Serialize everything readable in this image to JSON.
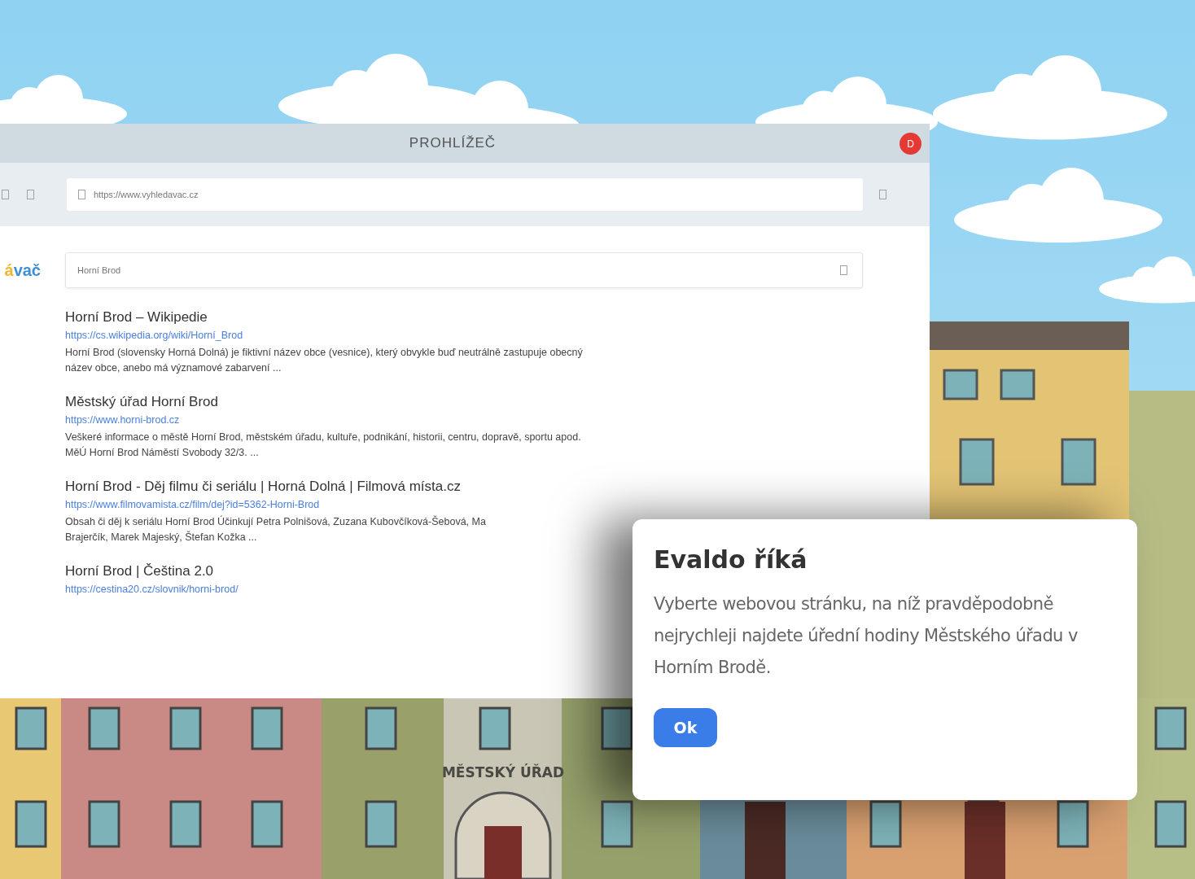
{
  "scene": {
    "building_sign": "MĚSTSKÝ ÚŘAD"
  },
  "browser": {
    "title": "PROHLÍŽEČ",
    "close_label": "D",
    "address": "https://www.vyhledavac.cz",
    "logo": [
      {
        "text": "á",
        "color": "#f2b632"
      },
      {
        "text": "vač",
        "color": "#3d8fd6"
      }
    ],
    "search": {
      "value": "Horní Brod"
    },
    "results": [
      {
        "title": "Horní Brod – Wikipedie",
        "url": "https://cs.wikipedia.org/wiki/Horní_Brod",
        "snippet": [
          "Horní Brod (slovensky Horná Dolná) je fiktivní název obce (vesnice), který obvykle buď neutrálně zastupuje obecný",
          "název obce, anebo má významové zabarvení ..."
        ]
      },
      {
        "title": "Městský úřad Horní Brod",
        "url": "https://www.horni-brod.cz",
        "snippet": [
          "Veškeré informace o městě Horní Brod, městském úřadu, kultuře, podnikání, historii, centru, dopravě, sportu apod.",
          "MěÚ Horní Brod Náměstí Svobody 32/3. ..."
        ]
      },
      {
        "title": "Horní Brod - Děj filmu či seriálu | Horná Dolná | Filmová místa.cz",
        "url": "https://www.filmovamista.cz/film/dej?id=5362-Horni-Brod",
        "snippet": [
          "Obsah či děj k seriálu Horní Brod Účinkují Petra Polnišová, Zuzana Kubovčíková-Šebová, Ma",
          "Brajerčík, Marek Majeský, Štefan Kožka ..."
        ]
      },
      {
        "title": "Horní Brod | Čeština 2.0",
        "url": "https://cestina20.cz/slovnik/horni-brod/"
      }
    ]
  },
  "dialog": {
    "title": "Evaldo říká",
    "message": "Vyberte webovou stránku, na níž pravděpodobně nejrychleji najdete úřední hodiny Městského úřadu v Horním Brodě.",
    "button": "Ok"
  }
}
